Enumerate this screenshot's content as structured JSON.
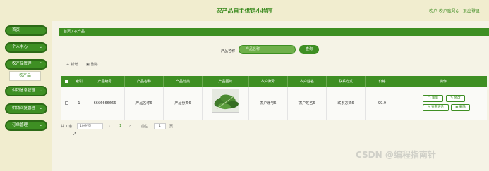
{
  "header": {
    "title": "农产品自主供销小程序",
    "user": "农户 农户账号6",
    "logout": "退出登录"
  },
  "sidebar": {
    "items": [
      {
        "label": "首页",
        "chevron": ""
      },
      {
        "label": "个人中心",
        "chevron": "⌄"
      },
      {
        "label": "农产品管理",
        "chevron": "⌃"
      },
      {
        "label": "农产品",
        "chevron": ""
      },
      {
        "label": "供销信息管理",
        "chevron": "⌄"
      },
      {
        "label": "供销回复管理",
        "chevron": "⌄"
      },
      {
        "label": "订单管理",
        "chevron": "⌄"
      }
    ]
  },
  "breadcrumb": {
    "home": "首页",
    "sep": "/",
    "current": "农产品"
  },
  "search": {
    "label": "产品名称",
    "placeholder": "产品名称",
    "button": "查询"
  },
  "actions": {
    "add": "新增",
    "delete": "删除",
    "add_icon": "+",
    "delete_icon": "▣"
  },
  "table": {
    "headers": [
      "索引",
      "产品编号",
      "产品名称",
      "产品分类",
      "产品图片",
      "农户账号",
      "农户姓名",
      "联系方式",
      "价格",
      "操作"
    ],
    "rows": [
      {
        "index": "1",
        "code": "6666666666",
        "name": "产品名称6",
        "category": "产品分类6",
        "farmer_account": "农户账号6",
        "farmer_name": "农户姓名6",
        "contact": "联系方式6",
        "price": "99.9"
      }
    ],
    "ops": {
      "detail": "详情",
      "edit": "修改",
      "review": "查看评论",
      "delete": "删除"
    }
  },
  "pager": {
    "total": "共 1 条",
    "page_size": "10条/页",
    "prev": "‹",
    "page": "1",
    "next": "›",
    "goto": "前往",
    "goto_page": "1",
    "page_unit": "页"
  },
  "watermark": "CSDN @编程指南针",
  "colors": {
    "primary": "#3e8f23",
    "bg": "#f3efd9"
  }
}
